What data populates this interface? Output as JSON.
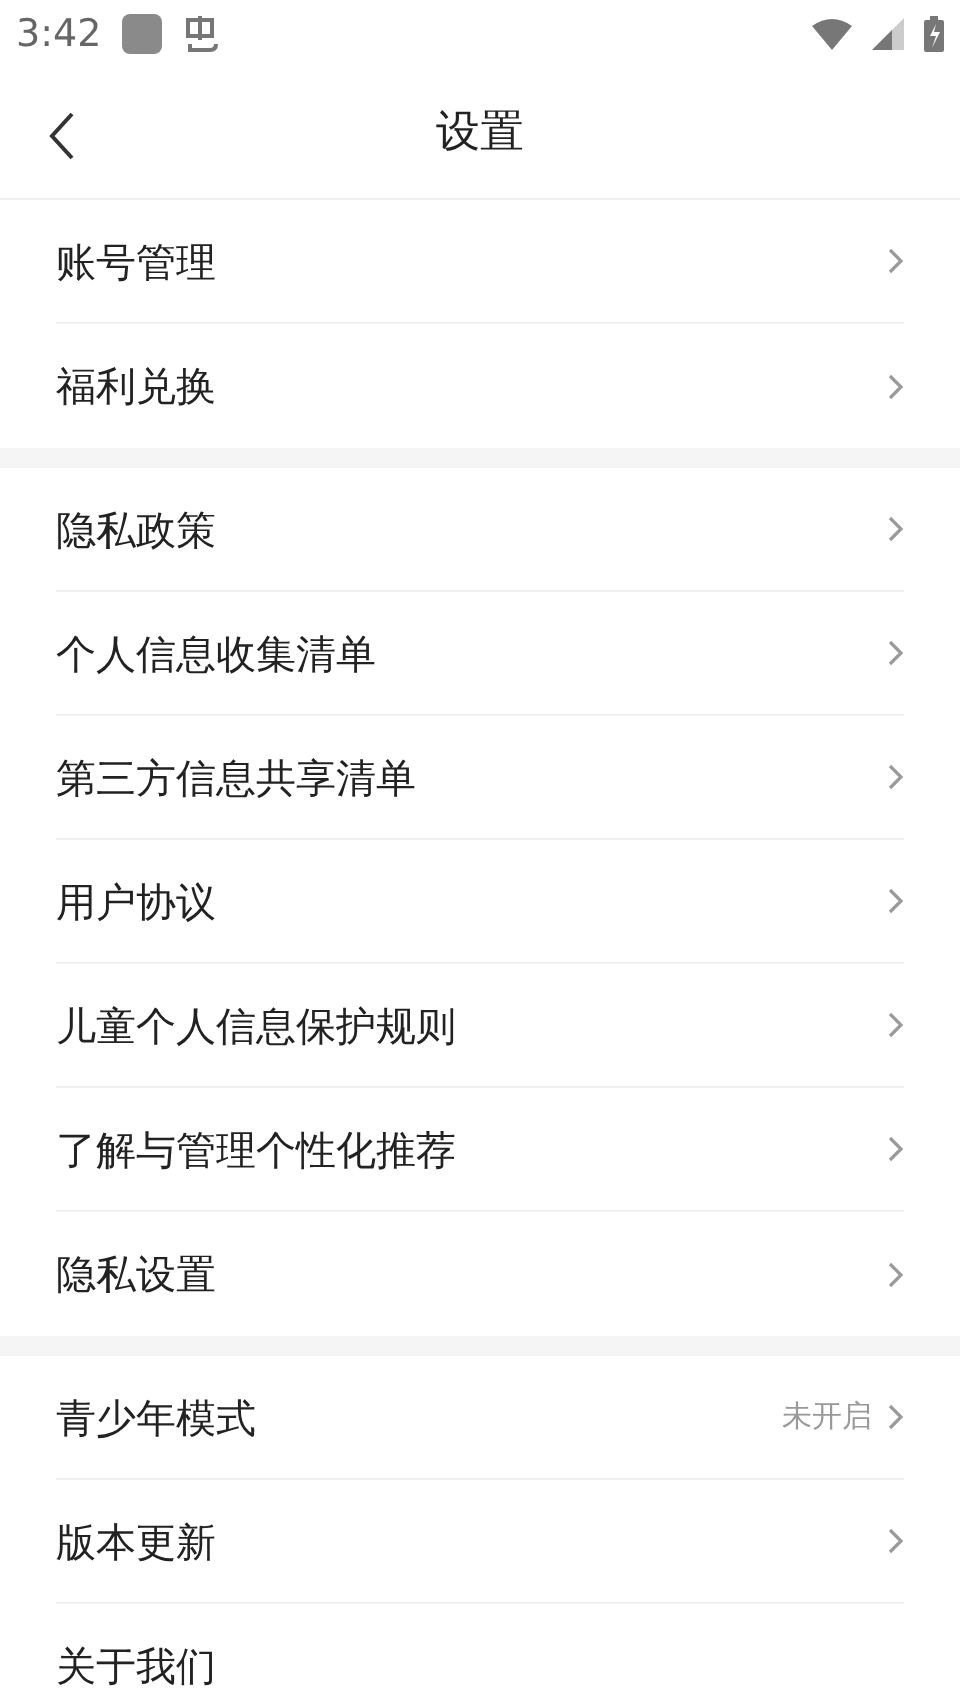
{
  "status_bar": {
    "time": "3:42"
  },
  "header": {
    "title": "设置"
  },
  "groups": [
    {
      "items": [
        {
          "label": "账号管理",
          "chevron": true
        },
        {
          "label": "福利兑换",
          "chevron": true
        }
      ]
    },
    {
      "items": [
        {
          "label": "隐私政策",
          "chevron": true
        },
        {
          "label": "个人信息收集清单",
          "chevron": true
        },
        {
          "label": "第三方信息共享清单",
          "chevron": true
        },
        {
          "label": "用户协议",
          "chevron": true
        },
        {
          "label": "儿童个人信息保护规则",
          "chevron": true
        },
        {
          "label": "了解与管理个性化推荐",
          "chevron": true
        },
        {
          "label": "隐私设置",
          "chevron": true
        }
      ]
    },
    {
      "items": [
        {
          "label": "青少年模式",
          "value": "未开启",
          "chevron": true
        },
        {
          "label": "版本更新",
          "chevron": true
        },
        {
          "label": "关于我们",
          "chevron": false
        }
      ]
    }
  ]
}
